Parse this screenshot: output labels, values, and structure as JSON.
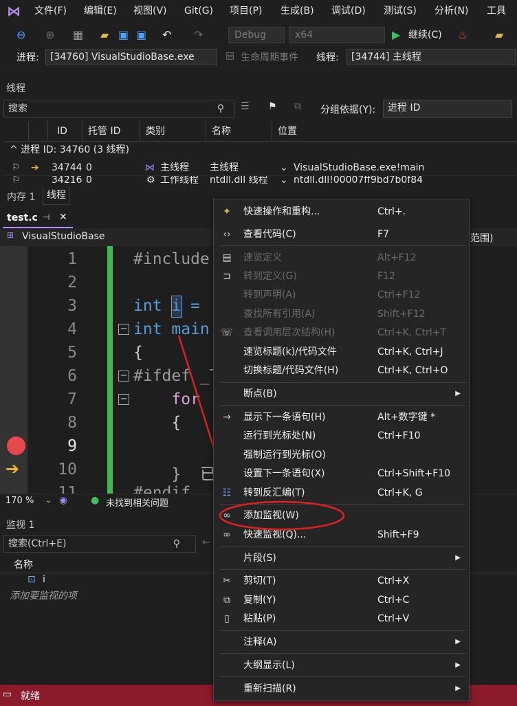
{
  "menubar": {
    "items": [
      "文件(F)",
      "编辑(E)",
      "视图(V)",
      "Git(G)",
      "项目(P)",
      "生成(B)",
      "调试(D)",
      "测试(S)",
      "分析(N)",
      "工具"
    ]
  },
  "toolbar": {
    "config": "Debug",
    "platform": "x64",
    "continue": "继续(C)"
  },
  "toolbar2": {
    "process_label": "进程:",
    "process_value": "[34760] VisualStudioBase.exe",
    "lifecycle": "生命周期事件",
    "thread_label": "线程:",
    "thread_value": "[34744] 主线程"
  },
  "threads": {
    "title": "线程",
    "search_placeholder": "搜索",
    "group_by_label": "分组依据(Y):",
    "group_by_value": "进程 ID",
    "columns": [
      "ID",
      "托管 ID",
      "类别",
      "名称",
      "位置"
    ],
    "group_row": "进程 ID: 34760  (3 线程)",
    "rows": [
      {
        "id": "34744",
        "managed_id": "0",
        "category": "主线程",
        "name": "主线程",
        "location": "VisualStudioBase.exe!main"
      },
      {
        "id": "34216",
        "managed_id": "0",
        "category": "工作线程",
        "name": "ntdll.dll 线程",
        "location": "ntdll.dll!00007ff9bd7b0f84"
      }
    ]
  },
  "bottom_tabs": [
    "内存 1",
    "线程"
  ],
  "editor": {
    "tab": "test.c",
    "project": "VisualStudioBase",
    "scope": "范围)",
    "line_numbers": [
      "1",
      "2",
      "3",
      "4",
      "5",
      "6",
      "7",
      "8",
      "9",
      "10",
      "11"
    ],
    "lines": [
      "#include",
      "",
      "int i = ",
      "int main",
      "{",
      "#ifdef _T",
      "    for",
      "    {",
      "",
      "    }  已用",
      "#endif"
    ],
    "zoom": "170 %",
    "issues": "未找到相关问题"
  },
  "watch": {
    "title": "监视 1",
    "search_placeholder": "搜索(Ctrl+E)",
    "column_name": "名称",
    "item_name": "i",
    "add_item": "添加要监视的项"
  },
  "status": {
    "text": "就绪"
  },
  "context_menu": {
    "items": [
      {
        "label": "快速操作和重构...",
        "shortcut": "Ctrl+.",
        "icon": "lightbulb-icon"
      },
      {
        "label": "查看代码(C)",
        "shortcut": "F7",
        "icon": "code-icon"
      },
      {
        "label": "速览定义",
        "shortcut": "Alt+F12",
        "icon": "peek-definition-icon",
        "disabled": true
      },
      {
        "label": "转到定义(G)",
        "shortcut": "F12",
        "icon": "goto-definition-icon",
        "disabled": true
      },
      {
        "label": "转到声明(A)",
        "shortcut": "Ctrl+F12",
        "disabled": true
      },
      {
        "label": "查找所有引用(A)",
        "shortcut": "Shift+F12",
        "disabled": true
      },
      {
        "label": "查看调用层次结构(H)",
        "shortcut": "Ctrl+K, Ctrl+T",
        "icon": "call-hierarchy-icon",
        "disabled": true
      },
      {
        "label": "速览标题(k)/代码文件",
        "shortcut": "Ctrl+K, Ctrl+J"
      },
      {
        "label": "切换标题/代码文件(H)",
        "shortcut": "Ctrl+K, Ctrl+O"
      },
      {
        "label": "断点(B)",
        "submenu": true
      },
      {
        "label": "显示下一条语句(H)",
        "shortcut": "Alt+数字键 *",
        "icon": "arrow-right-icon"
      },
      {
        "label": "运行到光标处(N)",
        "shortcut": "Ctrl+F10"
      },
      {
        "label": "强制运行到光标(O)"
      },
      {
        "label": "设置下一条语句(X)",
        "shortcut": "Ctrl+Shift+F10"
      },
      {
        "label": "转到反汇编(T)",
        "shortcut": "Ctrl+K, G",
        "icon": "disassembly-icon"
      },
      {
        "label": "添加监视(W)",
        "icon": "glasses-icon"
      },
      {
        "label": "快速监视(Q)...",
        "shortcut": "Shift+F9",
        "icon": "glasses-icon"
      },
      {
        "label": "片段(S)",
        "submenu": true
      },
      {
        "label": "剪切(T)",
        "shortcut": "Ctrl+X",
        "icon": "scissors-icon"
      },
      {
        "label": "复制(Y)",
        "shortcut": "Ctrl+C",
        "icon": "copy-icon"
      },
      {
        "label": "粘贴(P)",
        "shortcut": "Ctrl+V",
        "icon": "paste-icon"
      },
      {
        "label": "注释(A)",
        "submenu": true
      },
      {
        "label": "大纲显示(L)",
        "submenu": true
      },
      {
        "label": "重新扫描(R)",
        "submenu": true
      }
    ]
  },
  "colors": {
    "accent": "#b48cf0",
    "status_bar": "#8b1a2b",
    "annotation": "#e02020",
    "breakpoint": "#e5484d",
    "current_line_arrow": "#f0b429"
  }
}
